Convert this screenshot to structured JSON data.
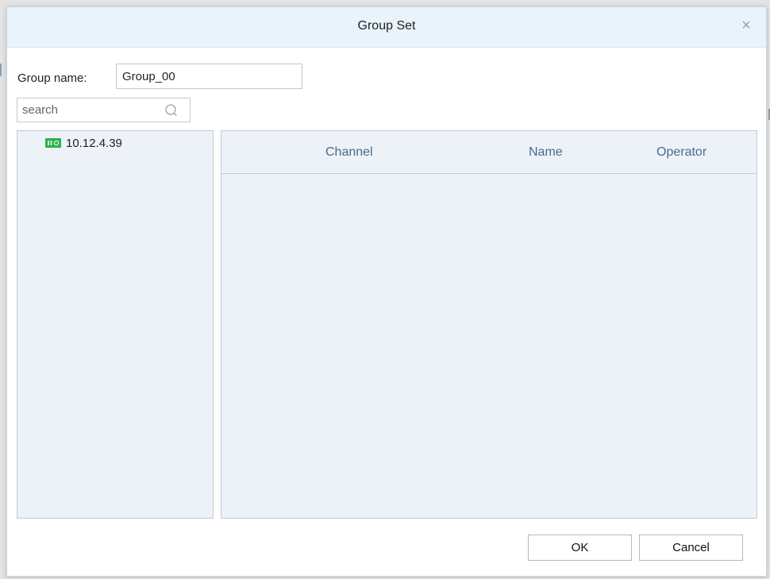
{
  "dialog": {
    "title": "Group Set",
    "close_symbol": "×"
  },
  "form": {
    "group_name_label": "Group name:",
    "group_name_value": "Group_00",
    "search_placeholder": "search"
  },
  "tree": {
    "items": [
      {
        "label": "10.12.4.39",
        "icon": "device-icon",
        "icon_color": "#2bb24c"
      }
    ]
  },
  "table": {
    "columns": [
      "Channel",
      "Name",
      "Operator"
    ],
    "rows": []
  },
  "buttons": {
    "ok": "OK",
    "cancel": "Cancel"
  },
  "colors": {
    "title_bar_bg": "#e9f3fb",
    "panel_bg": "#edf2f8",
    "header_text": "#4a6a8a"
  }
}
